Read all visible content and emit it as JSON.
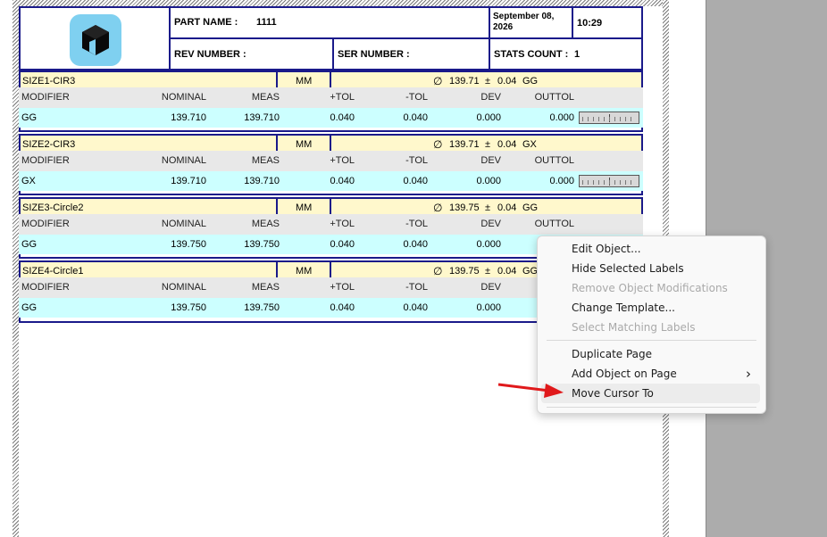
{
  "header": {
    "part_name_label": "PART NAME :",
    "part_name_value": "1111",
    "date": "September 08,\n2026",
    "date_line1": "September 08,",
    "date_line2": "2026",
    "time": "10:29",
    "rev_number_label": "REV NUMBER :",
    "ser_number_label": "SER NUMBER :",
    "stats_count_label": "STATS COUNT :",
    "stats_count_value": "1"
  },
  "columns": {
    "modifier": "MODIFIER",
    "nominal": "NOMINAL",
    "meas": "MEAS",
    "plus_tol": "+TOL",
    "minus_tol": "-TOL",
    "dev": "DEV",
    "outtol": "OUTTOL"
  },
  "features": [
    {
      "name": "SIZE1-CIR3",
      "unit": "MM",
      "dim_symbol": "∅",
      "dim_value": "139.71",
      "pm": "±",
      "tol": "0.04",
      "dim_mod": "GG",
      "row": {
        "modifier": "GG",
        "nominal": "139.710",
        "meas": "139.710",
        "plus_tol": "0.040",
        "minus_tol": "0.040",
        "dev": "0.000",
        "outtol": "0.000"
      }
    },
    {
      "name": "SIZE2-CIR3",
      "unit": "MM",
      "dim_symbol": "∅",
      "dim_value": "139.71",
      "pm": "±",
      "tol": "0.04",
      "dim_mod": "GX",
      "row": {
        "modifier": "GX",
        "nominal": "139.710",
        "meas": "139.710",
        "plus_tol": "0.040",
        "minus_tol": "0.040",
        "dev": "0.000",
        "outtol": "0.000"
      }
    },
    {
      "name": "SIZE3-Circle2",
      "unit": "MM",
      "dim_symbol": "∅",
      "dim_value": "139.75",
      "pm": "±",
      "tol": "0.04",
      "dim_mod": "GG",
      "row": {
        "modifier": "GG",
        "nominal": "139.750",
        "meas": "139.750",
        "plus_tol": "0.040",
        "minus_tol": "0.040",
        "dev": "0.000",
        "outtol": ""
      }
    },
    {
      "name": "SIZE4-Circle1",
      "unit": "MM",
      "dim_symbol": "∅",
      "dim_value": "139.75",
      "pm": "±",
      "tol": "0.04",
      "dim_mod": "GG",
      "row": {
        "modifier": "GG",
        "nominal": "139.750",
        "meas": "139.750",
        "plus_tol": "0.040",
        "minus_tol": "0.040",
        "dev": "0.000",
        "outtol": ""
      }
    }
  ],
  "context_menu": {
    "items": [
      {
        "label": "Edit Object...",
        "enabled": true
      },
      {
        "label": "Hide Selected Labels",
        "enabled": true
      },
      {
        "label": "Remove Object Modifications",
        "enabled": false
      },
      {
        "label": "Change Template...",
        "enabled": true
      },
      {
        "label": "Select Matching Labels",
        "enabled": false
      },
      {
        "label": "Duplicate Page",
        "enabled": true
      },
      {
        "label": "Add Object on Page",
        "enabled": true,
        "submenu_icon": "chevron-right-icon",
        "submenu_glyph": "›"
      },
      {
        "label": "Move Cursor To",
        "enabled": true,
        "highlighted": true
      }
    ]
  },
  "annotation": {
    "arrow_color": "#e0191b"
  },
  "colors": {
    "border": "#1a1a8a",
    "size_bar": "#fff8cc",
    "data_row": "#ccffff",
    "header_row": "#e8e8e8",
    "logo_bg": "#7fd0f0"
  }
}
